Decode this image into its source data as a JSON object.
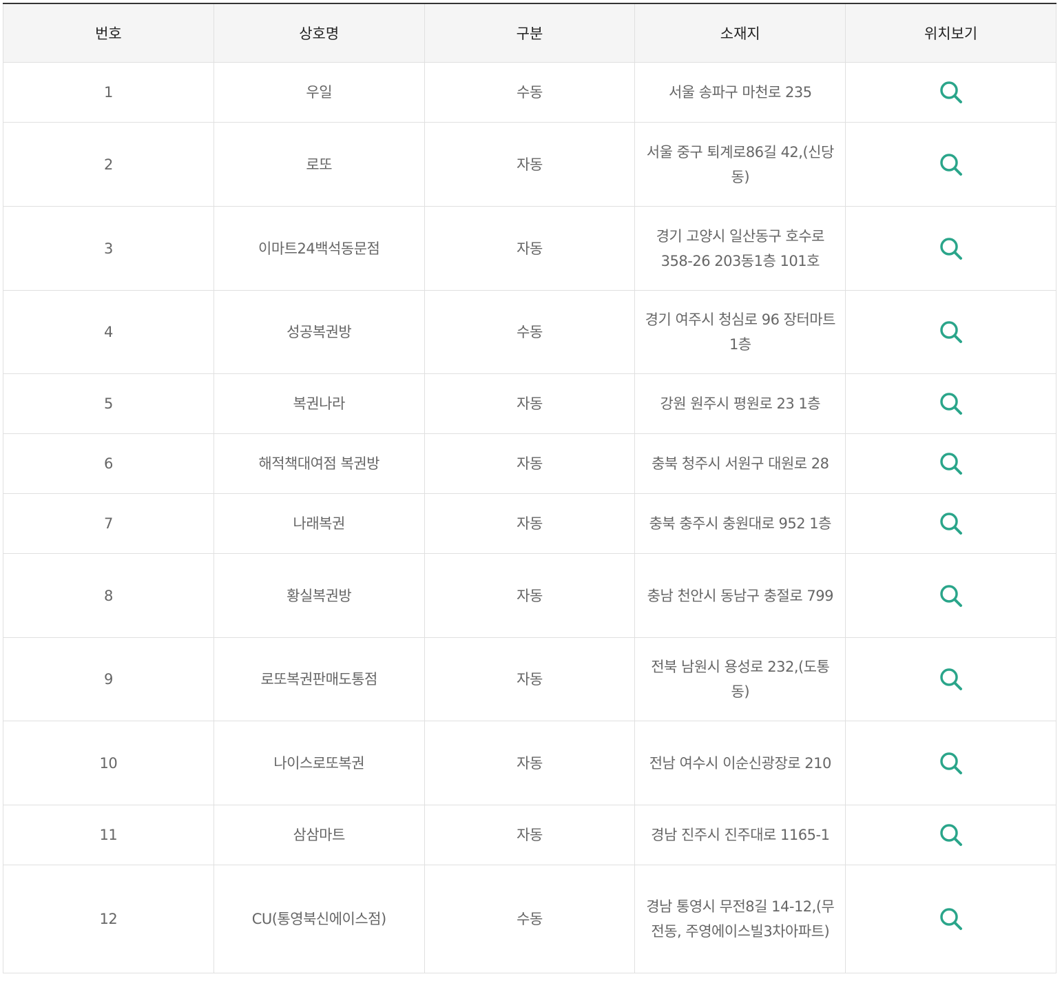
{
  "headers": [
    "번호",
    "상호명",
    "구분",
    "소재지",
    "위치보기"
  ],
  "icon_color": "#2aa58a",
  "rows": [
    {
      "no": "1",
      "name": "우일",
      "type": "수동",
      "address": "서울 송파구 마천로 235",
      "icon": "search-icon"
    },
    {
      "no": "2",
      "name": "로또",
      "type": "자동",
      "address": "서울 중구 퇴계로86길 42,(신당동)",
      "icon": "search-icon"
    },
    {
      "no": "3",
      "name": "이마트24백석동문점",
      "type": "자동",
      "address": "경기 고양시 일산동구 호수로 358-26 203동1층 101호",
      "icon": "search-icon"
    },
    {
      "no": "4",
      "name": "성공복권방",
      "type": "수동",
      "address": "경기 여주시 청심로 96 장터마트 1층",
      "icon": "search-icon"
    },
    {
      "no": "5",
      "name": "복권나라",
      "type": "자동",
      "address": "강원 원주시 평원로 23 1층",
      "icon": "search-icon"
    },
    {
      "no": "6",
      "name": "해적책대여점 복권방",
      "type": "자동",
      "address": "충북 청주시 서원구 대원로 28",
      "icon": "search-icon"
    },
    {
      "no": "7",
      "name": "나래복권",
      "type": "자동",
      "address": "충북 충주시 충원대로 952 1층",
      "icon": "search-icon"
    },
    {
      "no": "8",
      "name": "황실복권방",
      "type": "자동",
      "address": "충남 천안시 동남구 충절로 799",
      "icon": "search-icon"
    },
    {
      "no": "9",
      "name": "로또복권판매도통점",
      "type": "자동",
      "address": "전북 남원시 용성로 232,(도통동)",
      "icon": "search-icon"
    },
    {
      "no": "10",
      "name": "나이스로또복권",
      "type": "자동",
      "address": "전남 여수시 이순신광장로 210",
      "icon": "search-icon"
    },
    {
      "no": "11",
      "name": "삼삼마트",
      "type": "자동",
      "address": "경남 진주시 진주대로 1165-1",
      "icon": "search-icon"
    },
    {
      "no": "12",
      "name": "CU(통영북신에이스점)",
      "type": "수동",
      "address": "경남 통영시 무전8길 14-12,(무전동, 주영에이스빌3차아파트)",
      "icon": "search-icon"
    }
  ]
}
